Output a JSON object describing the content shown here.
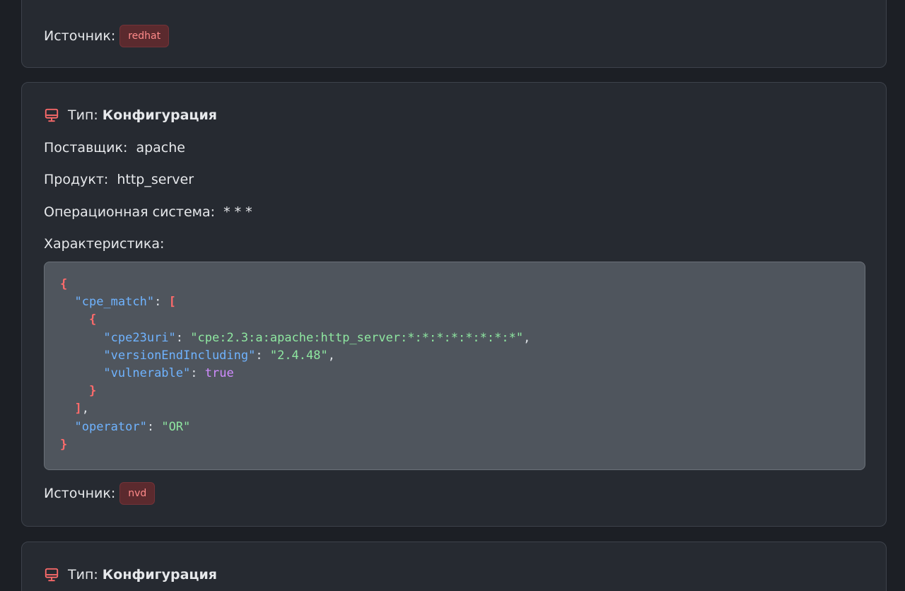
{
  "top_card": {
    "source_label": "Источник:",
    "source_badge": "redhat"
  },
  "config_card": {
    "type_label": "Тип:",
    "type_value": "Конфигурация",
    "vendor_label": "Поставщик:",
    "vendor_value": "apache",
    "product_label": "Продукт:",
    "product_value": "http_server",
    "os_label": "Операционная система:",
    "os_value": "* * *",
    "spec_label": "Характеристика:",
    "code": {
      "open_brace": "{",
      "cpe_match_key": "\"cpe_match\"",
      "open_bracket": "[",
      "inner_open": "{",
      "cpe23uri_key": "\"cpe23uri\"",
      "cpe23uri_value": "\"cpe:2.3:a:apache:http_server:*:*:*:*:*:*:*:*\"",
      "version_key": "\"versionEndIncluding\"",
      "version_value": "\"2.4.48\"",
      "vulnerable_key": "\"vulnerable\"",
      "vulnerable_value": "true",
      "inner_close": "}",
      "close_bracket": "]",
      "operator_key": "\"operator\"",
      "operator_value": "\"OR\"",
      "close_brace": "}"
    },
    "source_label": "Источник:",
    "source_badge": "nvd"
  },
  "bottom_card": {
    "type_label": "Тип:",
    "type_value": "Конфигурация"
  },
  "icons": {
    "type_icon": "monitor-icon"
  },
  "colors": {
    "background": "#1c1f25",
    "card": "#262a31",
    "code_bg": "#4f555d",
    "accent_red": "#ff6b6b",
    "badge_bg": "#5b2a2e",
    "badge_text": "#ff8a8a",
    "json_key": "#6fb3ff",
    "json_string": "#8ee6a0",
    "json_bool": "#d08cff"
  }
}
